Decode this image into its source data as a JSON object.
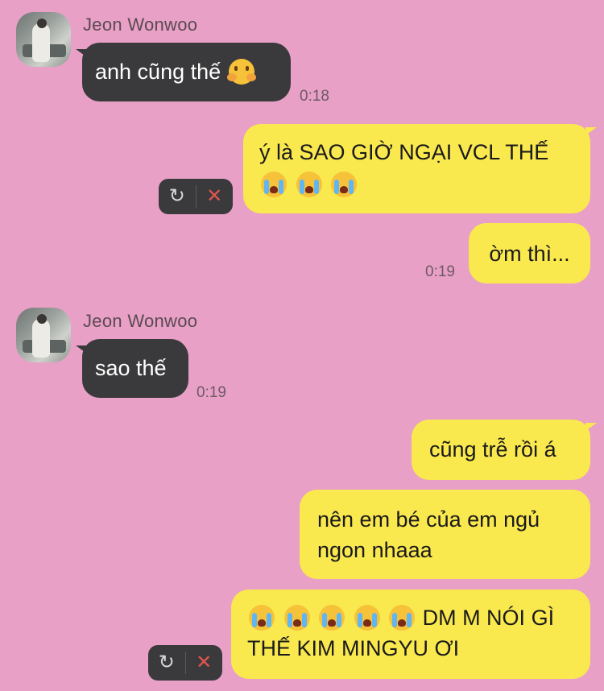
{
  "messages": [
    {
      "sender": "Jeon Wonwoo",
      "text": "anh cũng thế",
      "emoji": [
        "hug"
      ],
      "time": "0:18"
    },
    {
      "text": "ý là SAO GIỜ NGẠI VCL THẾ",
      "emoji": [
        "cry",
        "cry",
        "cry"
      ],
      "status": "failed"
    },
    {
      "text": "ờm thì...",
      "time": "0:19"
    },
    {
      "sender": "Jeon Wonwoo",
      "text": "sao thế",
      "time": "0:19"
    },
    {
      "text": "cũng trễ rồi á"
    },
    {
      "line1": "nên em bé của em ngủ",
      "line2": "ngon nhaaa"
    },
    {
      "emoji": [
        "cry",
        "cry",
        "cry",
        "cry",
        "cry"
      ],
      "line1": "DM M NÓI GÌ",
      "line2": "THẾ KIM MINGYU ƠI",
      "status": "failed"
    }
  ],
  "colors": {
    "background": "#e8a0c6",
    "incoming": "#3a3a3c",
    "outgoing": "#fae84f",
    "delete": "#e0564f"
  },
  "icons": {
    "retry": "retry-icon",
    "delete": "close-icon",
    "hug": "hugging-face-emoji",
    "cry": "loudly-crying-face-emoji"
  }
}
